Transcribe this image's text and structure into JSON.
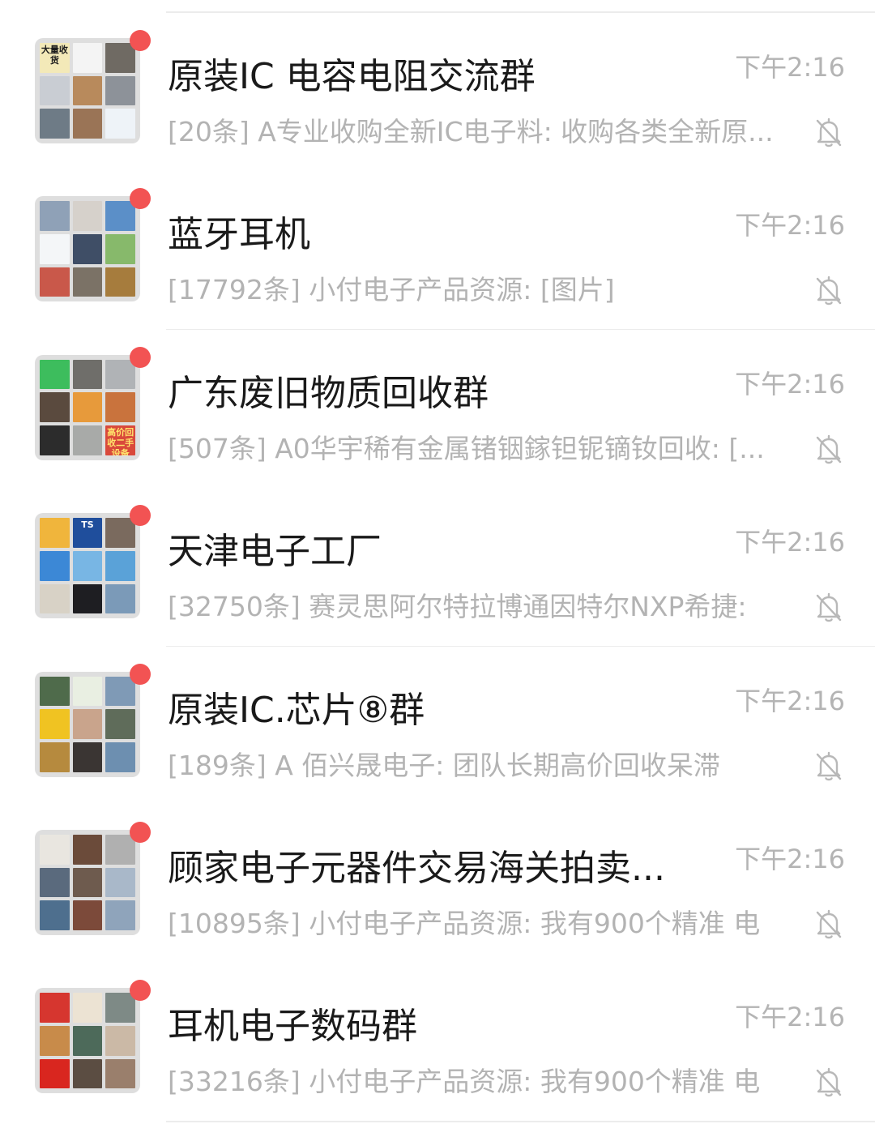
{
  "chats": [
    {
      "name": "原装IC 电容电阻交流群",
      "time": "下午2:16",
      "preview": "[20条] A专业收购全新IC电子料: 收购各类全新原...",
      "avatar_tiles": [
        "#f3e9b8",
        "#f4f4f4",
        "#6f6a63",
        "#c9cdd3",
        "#b88a5c",
        "#8d9299",
        "#6e7b86",
        "#9a7456",
        "#eef3f8"
      ],
      "avatar_labels": [
        {
          "tile": 0,
          "text": "大量收货",
          "color": "#1b1b1b"
        }
      ]
    },
    {
      "name": "蓝牙耳机",
      "time": "下午2:16",
      "preview": "[17792条] 小付电子产品资源: [图片]",
      "avatar_tiles": [
        "#8fa1b7",
        "#d6d1cb",
        "#5b8fc8",
        "#f4f6f8",
        "#3f4e66",
        "#87b96b",
        "#c9584a",
        "#7b7266",
        "#a67c3d"
      ],
      "avatar_labels": []
    },
    {
      "name": "广东废旧物质回收群",
      "time": "下午2:16",
      "preview": "[507条] A0华宇稀有金属锗铟鎵钽铌镝钕回收: [...",
      "avatar_tiles": [
        "#3dbd5d",
        "#6f6e6a",
        "#b0b3b6",
        "#5a4a3e",
        "#e79a3b",
        "#c9733d",
        "#2c2c2c",
        "#a8aaa8",
        "#d9493b"
      ],
      "avatar_labels": [
        {
          "tile": 8,
          "text": "高价回收二手设备",
          "color": "#ffe36b"
        }
      ]
    },
    {
      "name": "天津电子工厂",
      "time": "下午2:16",
      "preview": "[32750条] 赛灵思阿尔特拉博通因特尔NXP希捷:",
      "avatar_tiles": [
        "#f0b53c",
        "#1f4e9c",
        "#7a6a5e",
        "#3c88d6",
        "#78b6e4",
        "#5aa2d8",
        "#d8d2c6",
        "#1e1e22",
        "#7b9ab8"
      ],
      "avatar_labels": [
        {
          "tile": 1,
          "text": "TS",
          "color": "#ffffff"
        }
      ]
    },
    {
      "name": "原装IC.芯片⑧群",
      "time": "下午2:16",
      "preview": "[189条] A   佰兴晟电子: 团队长期高价回收呆滞",
      "avatar_tiles": [
        "#4f6b4b",
        "#e9efe2",
        "#7f9ab6",
        "#f0c322",
        "#c9a48c",
        "#5f6c5a",
        "#b68a3e",
        "#3a3533",
        "#6d8fb0"
      ],
      "avatar_labels": []
    },
    {
      "name": "顾家电子元器件交易海关拍卖...",
      "time": "下午2:16",
      "preview": "[10895条] 小付电子产品资源: 我有900个精准 电",
      "avatar_tiles": [
        "#e9e6e0",
        "#6b4b3a",
        "#b0b0b0",
        "#5a6a7d",
        "#6e5b4e",
        "#a9b8c9",
        "#4e6f8e",
        "#7c4a3a",
        "#8fa4bb"
      ],
      "avatar_labels": []
    },
    {
      "name": "耳机电子数码群",
      "time": "下午2:16",
      "preview": "[33216条] 小付电子产品资源: 我有900个精准 电",
      "avatar_tiles": [
        "#d6362f",
        "#ece3d3",
        "#7e8a86",
        "#c88b4a",
        "#4d6a5a",
        "#cbb9a6",
        "#d9261f",
        "#5b4d42",
        "#9a7f6c"
      ],
      "avatar_labels": []
    }
  ],
  "colors": {
    "background": "#ffffff",
    "divider": "#ececec",
    "unread_dot": "#f25353",
    "name_text": "#1a1a1a",
    "meta_text": "#b4b4b4"
  },
  "icons": {
    "mute": "bell-off-icon"
  }
}
